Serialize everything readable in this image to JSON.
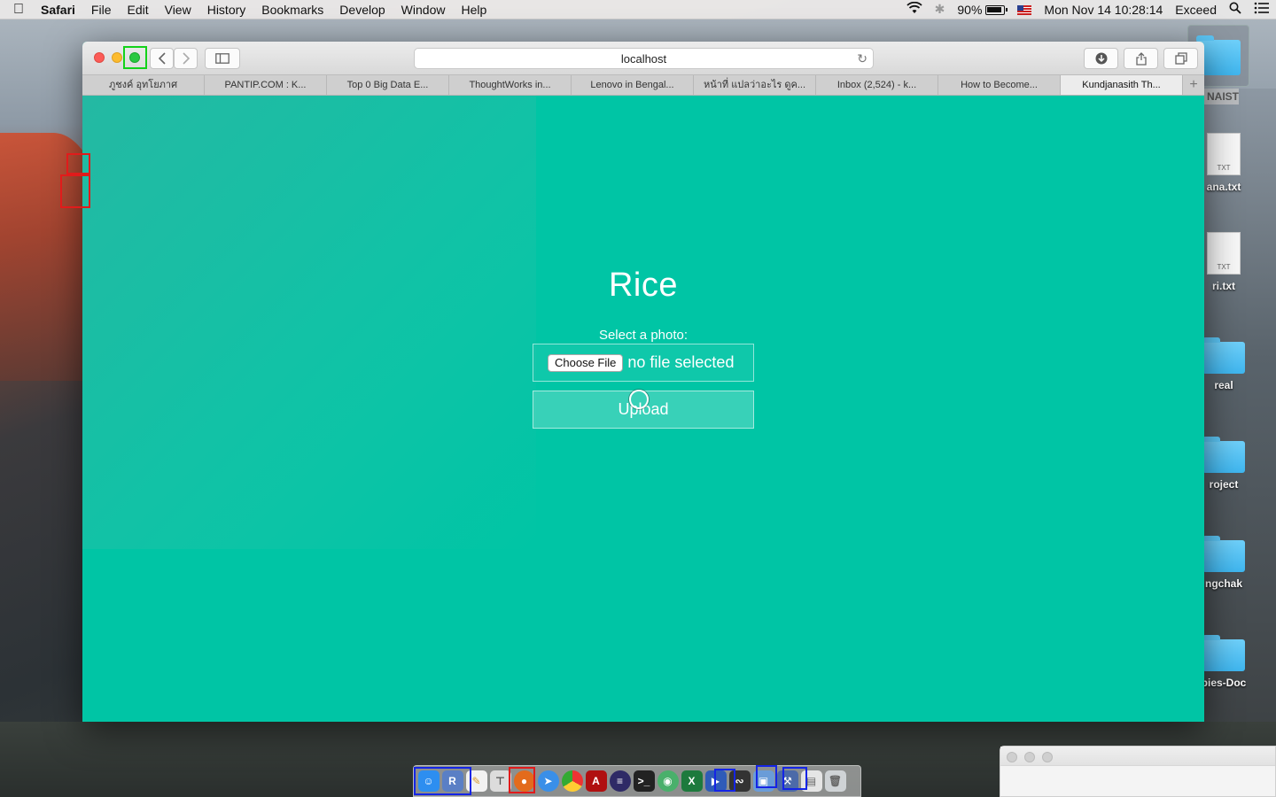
{
  "menubar": {
    "apple": "",
    "app": "Safari",
    "menus": [
      "File",
      "Edit",
      "View",
      "History",
      "Bookmarks",
      "Develop",
      "Window",
      "Help"
    ],
    "battery_pct": "90%",
    "datetime": "Mon Nov 14  10:28:14",
    "user": "Exceed"
  },
  "desktop": {
    "items": [
      {
        "label": "NAIST",
        "kind": "folder"
      },
      {
        "label": "ana.txt",
        "kind": "txt",
        "ext": "TXT"
      },
      {
        "label": "ri.txt",
        "kind": "txt",
        "ext": "TXT"
      },
      {
        "label": "real",
        "kind": "folder"
      },
      {
        "label": "roject",
        "kind": "folder"
      },
      {
        "label": "ngchak",
        "kind": "folder"
      },
      {
        "label": "bies-Doc",
        "kind": "folder"
      }
    ]
  },
  "browser": {
    "address": "localhost",
    "tabs": [
      "ภูชงค์ อุทโยภาศ",
      "PANTIP.COM : K...",
      "Top 0 Big Data E...",
      "ThoughtWorks in...",
      "Lenovo in Bengal...",
      "หน้าที่ แปลว่าอะไร ดูค...",
      "Inbox (2,524) - k...",
      "How to Become...",
      "Kundjanasith Th..."
    ],
    "active_tab_index": 8,
    "new_tab_glyph": "+"
  },
  "page": {
    "title": "Rice",
    "select_label": "Select a photo:",
    "choose_file": "Choose File",
    "no_file": "no file selected",
    "upload": "Upload",
    "background_color": "#00c5a5"
  },
  "dock": {
    "apps": [
      "finder",
      "r",
      "textedit",
      "script-editor",
      "firefox",
      "safari",
      "chrome",
      "acrobat",
      "eclipse",
      "terminal",
      "web",
      "excel",
      "visual-studio",
      "activity",
      "preview",
      "xcode",
      "preview-2",
      "trash"
    ]
  },
  "colors": {
    "accent": "#00c5a5",
    "annotation_red": "#e11b1b",
    "annotation_green": "#13d21a",
    "annotation_blue": "#1424e6"
  }
}
